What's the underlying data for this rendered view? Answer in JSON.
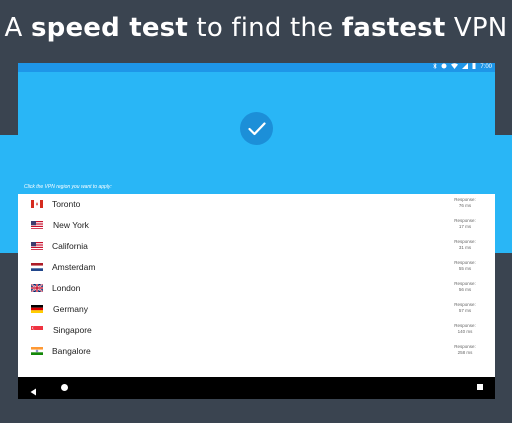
{
  "headline": {
    "part1": "A ",
    "part2": "speed test",
    "part3": " to find the ",
    "part4": "fastest",
    "part5": " VPN"
  },
  "status_bar": {
    "time": "7:00",
    "icons": [
      "bluetooth-icon",
      "alarm-icon",
      "wifi-icon",
      "signal-icon",
      "battery-icon"
    ]
  },
  "hero": {
    "hint": "Click the VPN region you want to apply:"
  },
  "regions": [
    {
      "name": "Toronto",
      "flag": "canada-flag-icon",
      "response_label": "Response:",
      "response_value": "76 ms"
    },
    {
      "name": "New York",
      "flag": "usa-flag-icon",
      "response_label": "Response:",
      "response_value": "17 ms"
    },
    {
      "name": "California",
      "flag": "usa-flag-icon",
      "response_label": "Response:",
      "response_value": "31 ms"
    },
    {
      "name": "Amsterdam",
      "flag": "netherlands-flag-icon",
      "response_label": "Response:",
      "response_value": "55 ms"
    },
    {
      "name": "London",
      "flag": "uk-flag-icon",
      "response_label": "Response:",
      "response_value": "56 ms"
    },
    {
      "name": "Germany",
      "flag": "germany-flag-icon",
      "response_label": "Response:",
      "response_value": "57 ms"
    },
    {
      "name": "Singapore",
      "flag": "singapore-flag-icon",
      "response_label": "Response:",
      "response_value": "140 ms"
    },
    {
      "name": "Bangalore",
      "flag": "india-flag-icon",
      "response_label": "Response:",
      "response_value": "258 ms"
    }
  ],
  "colors": {
    "accent": "#29b6f6",
    "status_bar": "#1e96e8",
    "check_circle": "#1c8fd8",
    "background": "#3a4450"
  }
}
